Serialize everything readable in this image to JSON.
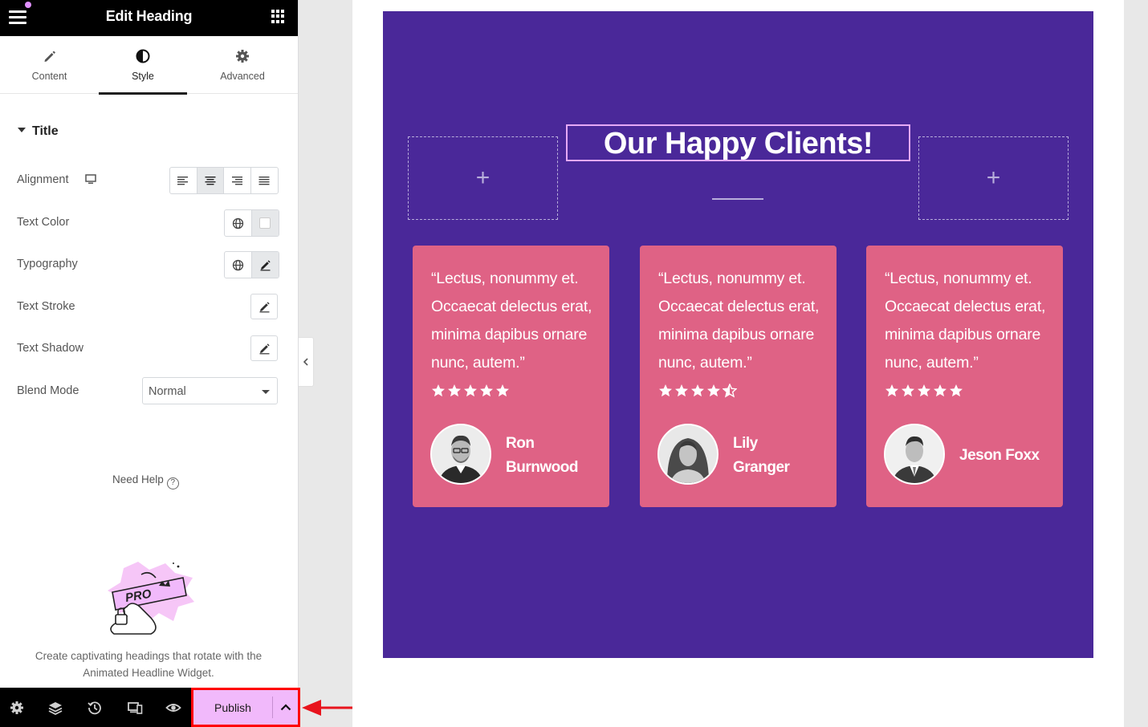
{
  "panel": {
    "title": "Edit Heading",
    "tabs": [
      {
        "label": "Content",
        "icon": "pencil-icon"
      },
      {
        "label": "Style",
        "icon": "contrast-icon",
        "active": true
      },
      {
        "label": "Advanced",
        "icon": "gear-icon"
      }
    ],
    "section_title": "Title",
    "controls": {
      "alignment": "Alignment",
      "text_color": "Text Color",
      "typography": "Typography",
      "text_stroke": "Text Stroke",
      "text_shadow": "Text Shadow",
      "blend_mode": "Blend Mode",
      "blend_mode_value": "Normal"
    },
    "alignment_selected": "center",
    "need_help": "Need Help",
    "promo_badge": "PRO",
    "promo_text": "Create captivating headings that rotate with the Animated Headline Widget."
  },
  "bottom_bar": {
    "publish_label": "Publish"
  },
  "canvas": {
    "heading": "Our Happy Clients!",
    "empty_column_symbol": "+",
    "testimonials": [
      {
        "quote": "“Lectus, nonummy et. Occaecat delectus erat, minima dapibus ornare nunc, autem.”",
        "rating": 5,
        "name_line1": "Ron",
        "name_line2": "Burnwood"
      },
      {
        "quote": "“Lectus, nonummy et. Occaecat delectus erat, minima dapibus ornare nunc, autem.”",
        "rating": 4.5,
        "name_line1": "Lily",
        "name_line2": "Granger"
      },
      {
        "quote": "“Lectus, nonummy et. Occaecat delectus erat, minima dapibus ornare nunc, autem.”",
        "rating": 5,
        "name_line1": "Jeson Foxx",
        "name_line2": ""
      }
    ]
  },
  "colors": {
    "section_bg": "#4a2899",
    "card_bg": "#df6285",
    "publish_bg": "#f1b9fb",
    "highlight": "#ff0000"
  }
}
